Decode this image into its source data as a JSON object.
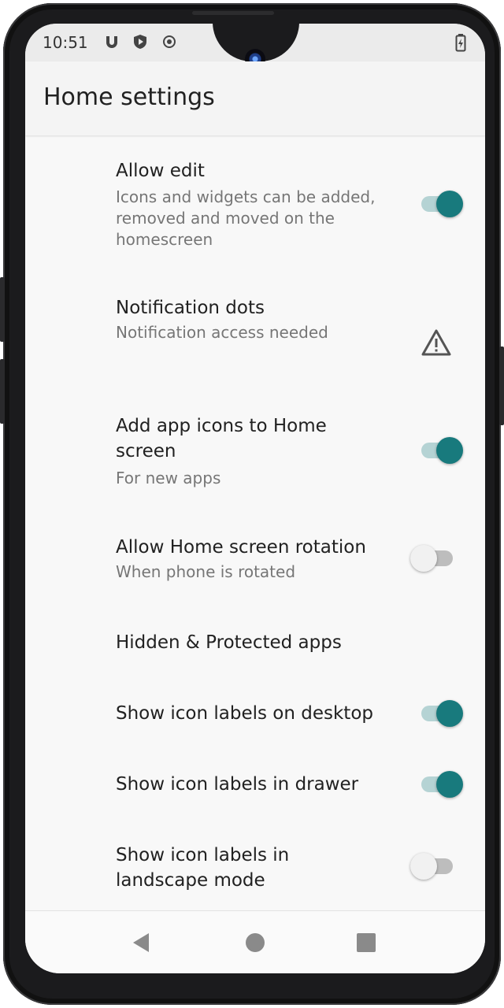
{
  "status_bar": {
    "time": "10:51",
    "icons": [
      "face-badge-icon",
      "shield-icon",
      "record-icon",
      "battery-charging-icon"
    ]
  },
  "app_bar": {
    "title": "Home settings"
  },
  "settings": [
    {
      "title": "Allow edit",
      "summary": "Icons and widgets can be added, removed and moved on the homescreen",
      "control": "switch",
      "checked": true
    },
    {
      "title": "Notification dots",
      "summary": "Notification access needed",
      "control": "warning-icon"
    },
    {
      "title": "Add app icons to Home screen",
      "summary": "For new apps",
      "control": "switch",
      "checked": true
    },
    {
      "title": "Allow Home screen rotation",
      "summary": "When phone is rotated",
      "control": "switch",
      "checked": false
    },
    {
      "title": "Hidden & Protected apps",
      "control": "none"
    },
    {
      "title": "Show icon labels on desktop",
      "control": "switch",
      "checked": true
    },
    {
      "title": "Show icon labels in drawer",
      "control": "switch",
      "checked": true
    },
    {
      "title": "Show icon labels in landscape mode",
      "control": "switch",
      "checked": false
    }
  ],
  "nav_bar": {
    "buttons": [
      "back-icon",
      "home-icon",
      "recents-icon"
    ]
  },
  "colors": {
    "accent": "#187a7d",
    "accent_track": "#b5d3d4",
    "background": "#f8f8f8",
    "app_bar": "#f4f4f4"
  }
}
